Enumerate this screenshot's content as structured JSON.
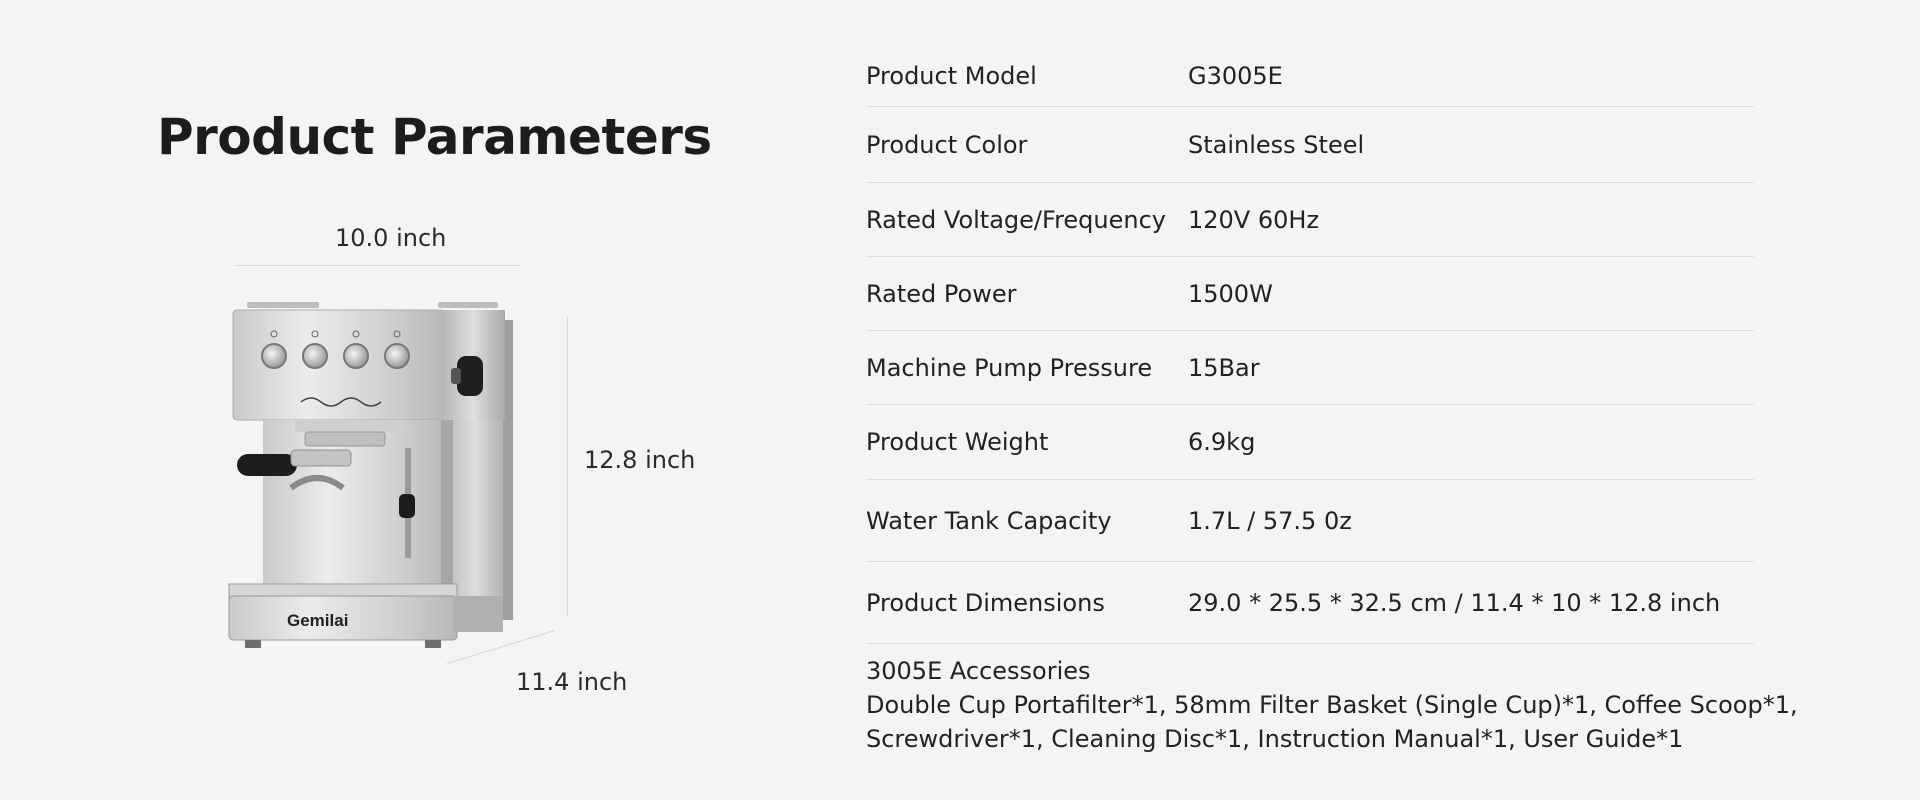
{
  "page": {
    "title": "Product Parameters"
  },
  "dimensions": {
    "width": "10.0 inch",
    "height": "12.8 inch",
    "depth": "11.4 inch"
  },
  "product_image": {
    "brand": "Gemilai",
    "color_body": "#d9d9d9",
    "color_knob": "#1a1a1a"
  },
  "specs": [
    {
      "name": "Product Model",
      "value": "G3005E"
    },
    {
      "name": "Product Color",
      "value": "Stainless Steel"
    },
    {
      "name": "Rated Voltage/Frequency",
      "value": "120V 60Hz"
    },
    {
      "name": "Rated Power",
      "value": "1500W"
    },
    {
      "name": "Machine Pump Pressure",
      "value": "15Bar"
    },
    {
      "name": "Product Weight",
      "value": "6.9kg"
    },
    {
      "name": "Water Tank Capacity",
      "value": "1.7L / 57.5 0z"
    },
    {
      "name": "Product Dimensions",
      "value": "29.0 * 25.5 * 32.5 cm / 11.4 * 10 * 12.8 inch"
    }
  ],
  "accessories": {
    "heading": "3005E Accessories",
    "line1": "Double Cup Portafilter*1, 58mm Filter Basket (Single Cup)*1, Coffee Scoop*1,",
    "line2": "Screwdriver*1, Cleaning Disc*1, Instruction Manual*1, User Guide*1"
  }
}
